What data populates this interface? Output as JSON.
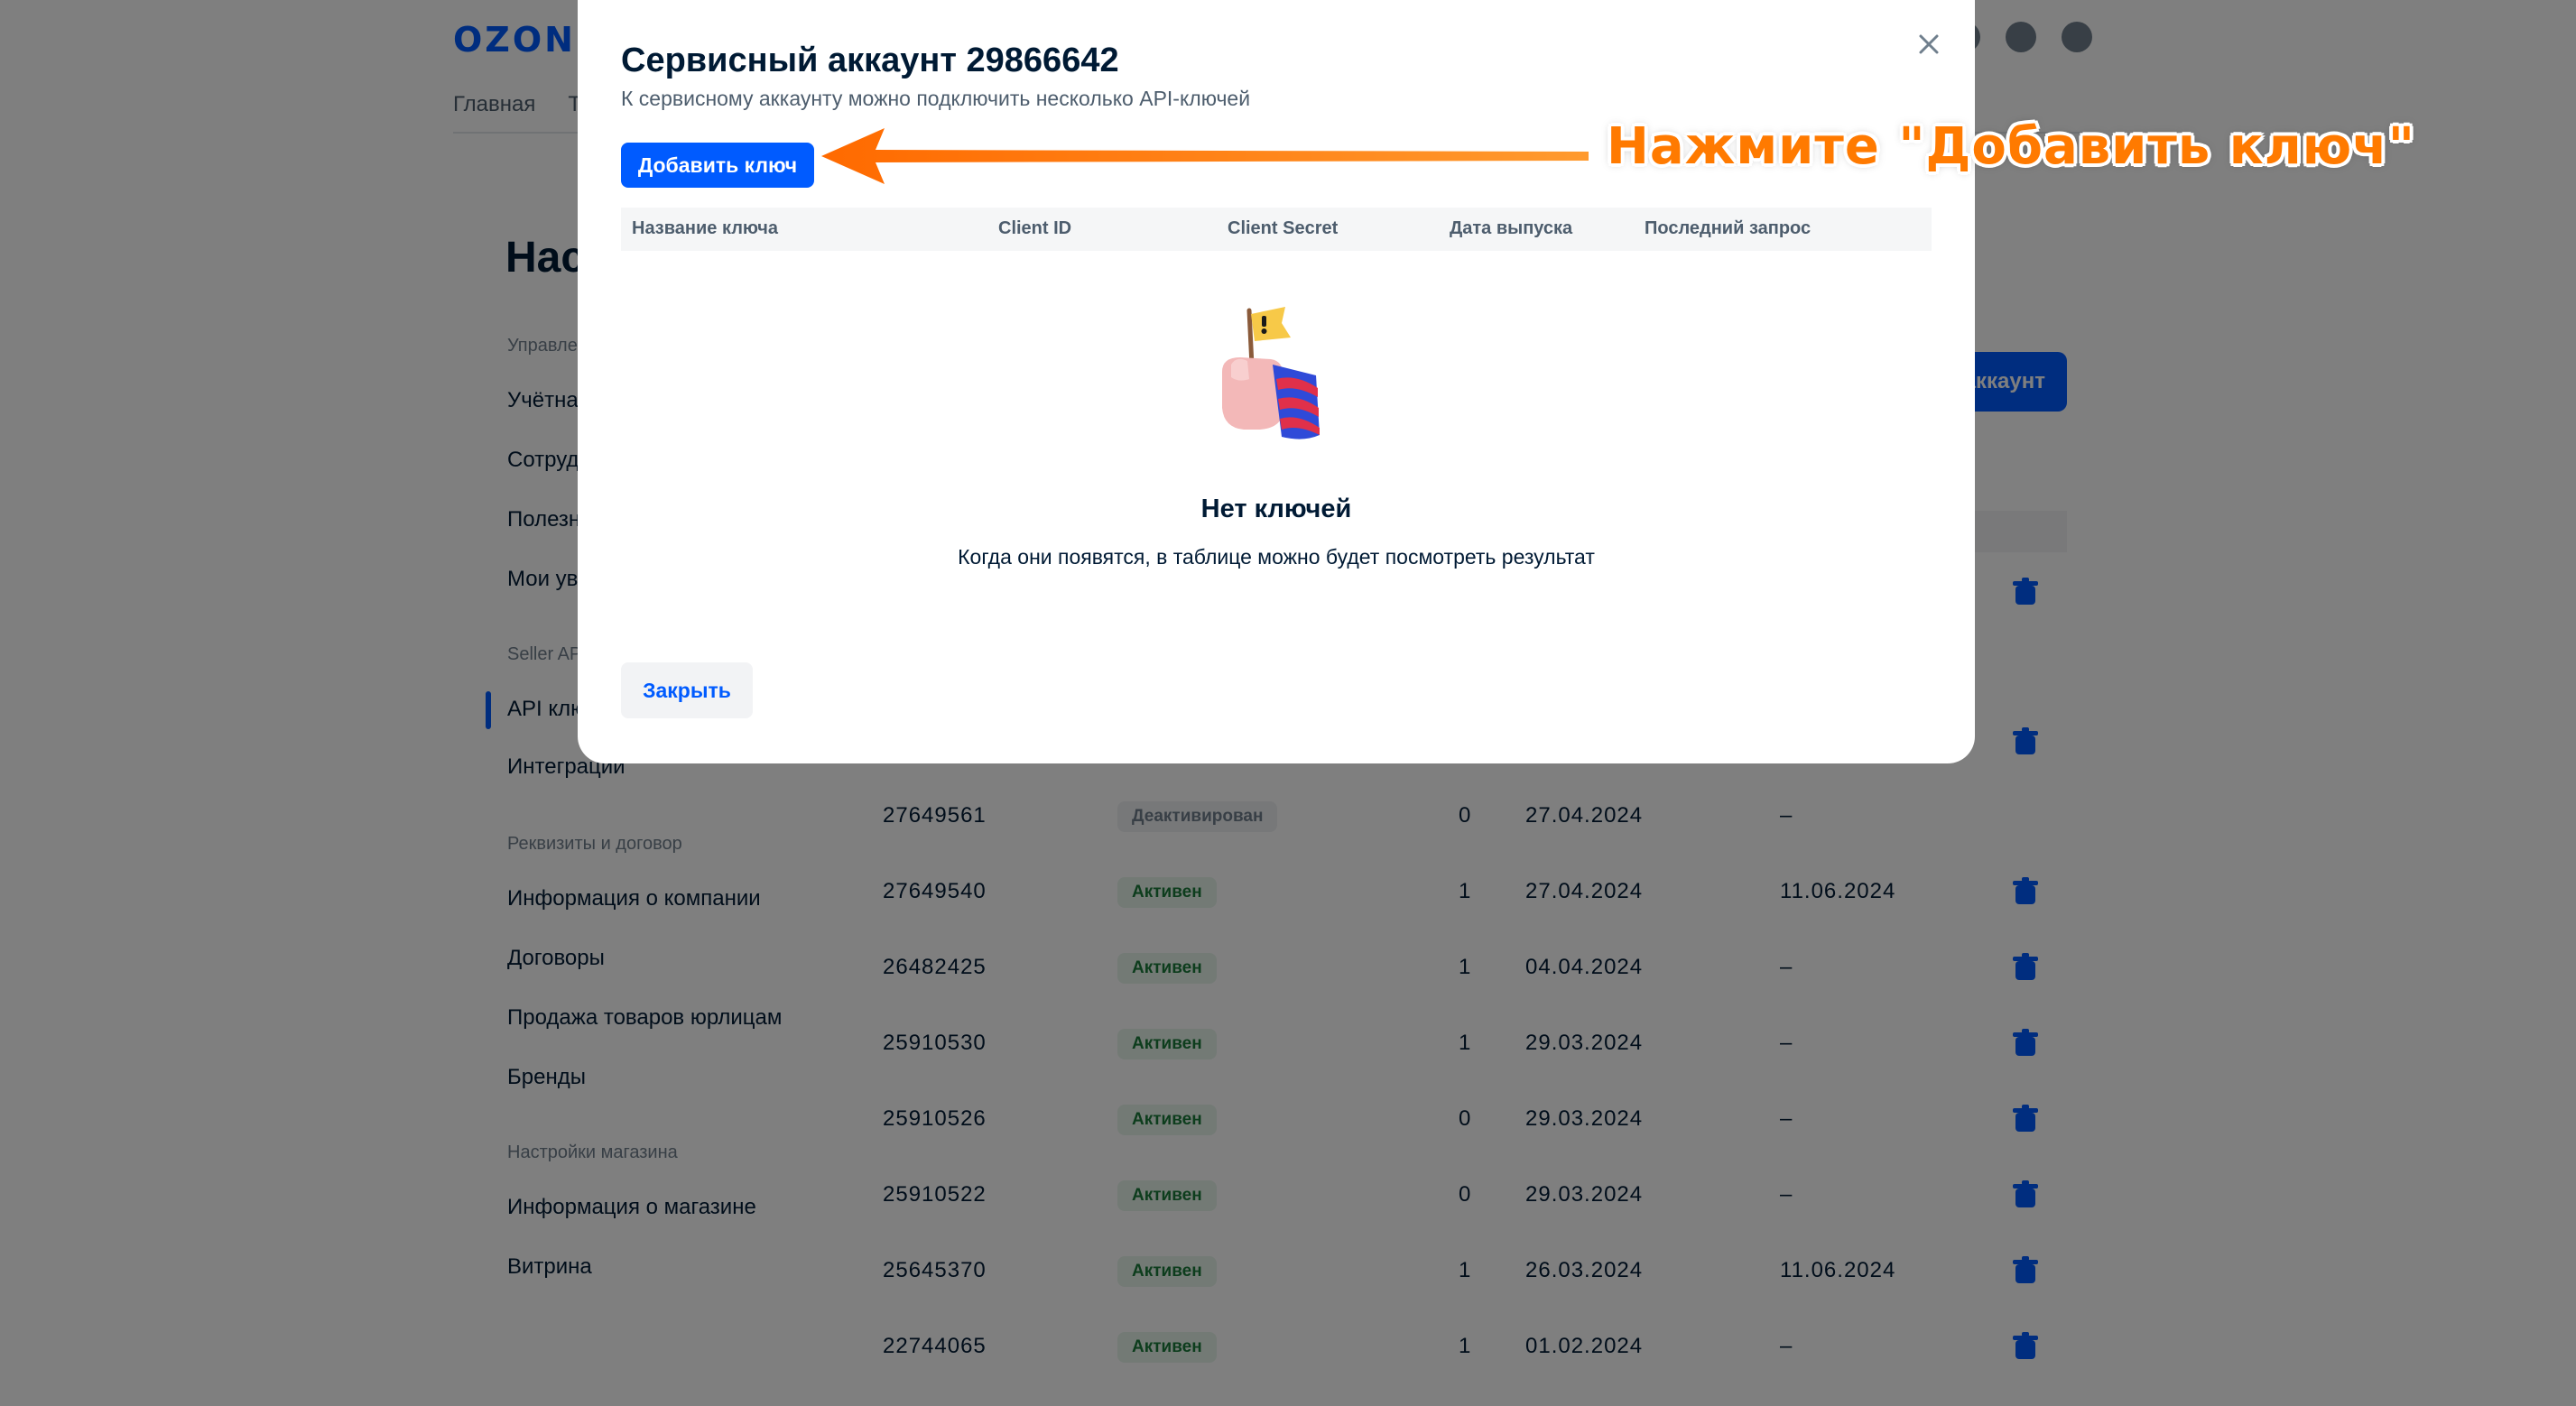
{
  "header": {
    "logo": "OZON",
    "nav": [
      "Главная",
      "Т"
    ]
  },
  "page": {
    "title": "Нас",
    "create_button": "аккаунт"
  },
  "sidebar": {
    "sections": [
      {
        "title": "Управле",
        "items": [
          "Учётна",
          "Сотруд",
          "Полезн",
          "Мои ув"
        ]
      },
      {
        "title": "Seller AP",
        "items": [
          "API клю",
          "Интеграции"
        ]
      },
      {
        "title": "Реквизиты и договор",
        "items": [
          "Информация о компании",
          "Договоры",
          "Продажа товаров юрлицам",
          "Бренды"
        ]
      },
      {
        "title": "Настройки магазина",
        "items": [
          "Информация о магазине",
          "Витрина"
        ]
      }
    ]
  },
  "accounts_table": {
    "rows": [
      {
        "id": "27649561",
        "status": "Деактивирован",
        "status_kind": "inactive",
        "count": "0",
        "date": "27.04.2024",
        "last": "–",
        "trash": false
      },
      {
        "id": "27649540",
        "status": "Активен",
        "status_kind": "active",
        "count": "1",
        "date": "27.04.2024",
        "last": "11.06.2024",
        "trash": true
      },
      {
        "id": "26482425",
        "status": "Активен",
        "status_kind": "active",
        "count": "1",
        "date": "04.04.2024",
        "last": "–",
        "trash": true
      },
      {
        "id": "25910530",
        "status": "Активен",
        "status_kind": "active",
        "count": "1",
        "date": "29.03.2024",
        "last": "–",
        "trash": true
      },
      {
        "id": "25910526",
        "status": "Активен",
        "status_kind": "active",
        "count": "0",
        "date": "29.03.2024",
        "last": "–",
        "trash": true
      },
      {
        "id": "25910522",
        "status": "Активен",
        "status_kind": "active",
        "count": "0",
        "date": "29.03.2024",
        "last": "–",
        "trash": true
      },
      {
        "id": "25645370",
        "status": "Активен",
        "status_kind": "active",
        "count": "1",
        "date": "26.03.2024",
        "last": "11.06.2024",
        "trash": true
      },
      {
        "id": "22744065",
        "status": "Активен",
        "status_kind": "active",
        "count": "1",
        "date": "01.02.2024",
        "last": "–",
        "trash": true
      }
    ]
  },
  "modal": {
    "title": "Сервисный аккаунт 29866642",
    "subtitle": "К сервисному аккаунту можно подключить несколько API-ключей",
    "add_key_button": "Добавить ключ",
    "annotation": "Нажмите \"Добавить ключ\"",
    "columns": [
      "Название ключа",
      "Client ID",
      "Client Secret",
      "Дата выпуска",
      "Последний запрос"
    ],
    "empty_title": "Нет ключей",
    "empty_description": "Когда они появятся, в таблице можно будет посмотреть результат",
    "close_button": "Закрыть"
  },
  "colors": {
    "brand_blue": "#005bff",
    "annotation_orange": "#ff7a00",
    "active_badge": "#e6f5ea",
    "overlay": "rgba(0,0,0,0.5)"
  }
}
